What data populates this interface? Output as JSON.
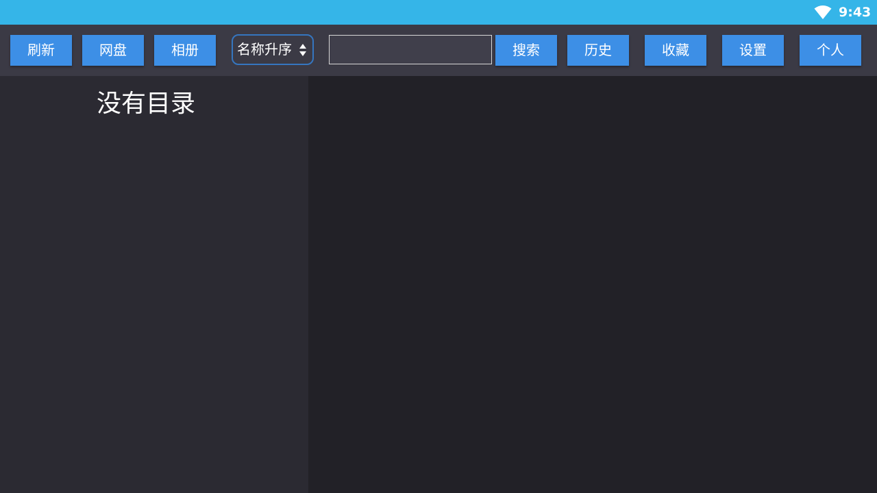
{
  "status_bar": {
    "time": "9:43",
    "wifi_icon": "wifi-icon",
    "bg_color": "#35b5e8"
  },
  "toolbar": {
    "refresh_label": "刷新",
    "netdisk_label": "网盘",
    "album_label": "相册",
    "sort": {
      "selected": "名称升序",
      "icon": "sort-arrows-icon"
    },
    "search": {
      "value": "",
      "placeholder": ""
    },
    "search_label": "搜索",
    "history_label": "历史",
    "favorites_label": "收藏",
    "settings_label": "设置",
    "profile_label": "个人",
    "button_color": "#3d8fe6"
  },
  "left_panel": {
    "empty_message": "没有目录"
  }
}
